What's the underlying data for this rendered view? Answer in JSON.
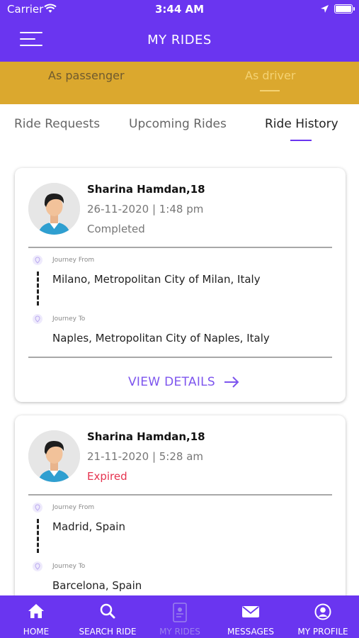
{
  "status_bar": {
    "carrier": "Carrier",
    "time": "3:44 AM"
  },
  "header": {
    "title": "MY RIDES"
  },
  "role_tabs": [
    {
      "label": "As passenger",
      "active": false
    },
    {
      "label": "As driver",
      "active": true
    }
  ],
  "ride_tabs": [
    {
      "label": "Ride Requests",
      "active": false
    },
    {
      "label": "Upcoming Rides",
      "active": false
    },
    {
      "label": "Ride History",
      "active": true
    }
  ],
  "rides": [
    {
      "name": "Sharina Hamdan,18",
      "datetime": "26-11-2020 | 1:48 pm",
      "status": "Completed",
      "from_label": "Journey From",
      "from": "Milano, Metropolitan City of Milan, Italy",
      "to_label": "Journey To",
      "to": "Naples, Metropolitan City of Naples, Italy",
      "action": "VIEW DETAILS"
    },
    {
      "name": "Sharina Hamdan,18",
      "datetime": "21-11-2020 | 5:28 am",
      "status": "Expired",
      "from_label": "Journey From",
      "from": "Madrid, Spain",
      "to_label": "Journey To",
      "to": "Barcelona, Spain"
    }
  ],
  "bottom_nav": [
    {
      "label": "HOME",
      "icon": "home-icon",
      "active": true
    },
    {
      "label": "SEARCH RIDE",
      "icon": "search-icon",
      "active": true
    },
    {
      "label": "MY RIDES",
      "icon": "rides-icon",
      "active": false
    },
    {
      "label": "MESSAGES",
      "icon": "envelope-icon",
      "active": true
    },
    {
      "label": "MY PROFILE",
      "icon": "profile-icon",
      "active": true
    }
  ],
  "colors": {
    "primary": "#6a35f0",
    "role_bar": "#dba82e",
    "active_role": "#f4d274",
    "expired": "#e5334f",
    "link": "#7d55ee"
  }
}
